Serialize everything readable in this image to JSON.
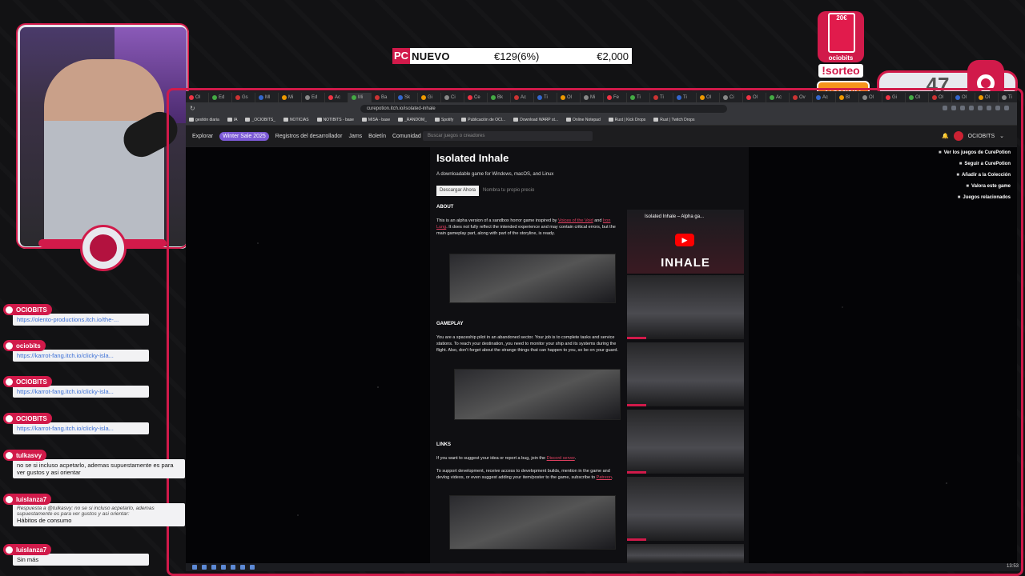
{
  "overlay": {
    "price_banner": {
      "store_mark": "PC",
      "game_name": "NUEVO",
      "discount_price": "€129(6%)",
      "full_price": "€2,000"
    },
    "badge": {
      "top_text": "20€",
      "label": "ociobits"
    },
    "sorteo": "!sorteo",
    "gaming_badge": "GAMING",
    "counter": "47"
  },
  "browser": {
    "tabs": [
      "Ol",
      "Ed",
      "Gs",
      "Ml",
      "Mi",
      "Ed",
      "Ac",
      "Mi",
      "Ba",
      "Sk",
      "Gi",
      "Ci",
      "Ce",
      "Bk",
      "Ac",
      "Ti",
      "Ol",
      "Mi",
      "Fe",
      "Ti",
      "Ti",
      "Ti",
      "Ol",
      "Ci",
      "Ol",
      "Ac",
      "Ov",
      "Ac",
      "Bl",
      "Ol",
      "Gi",
      "Ol",
      "Ol",
      "Ol",
      "Ol",
      "Ti",
      "Ol",
      "Ol",
      "Ol",
      "Ol",
      "Ol",
      "Ol",
      "Ol",
      "Ol"
    ],
    "url": "curepotion.itch.io/isolated-inhale",
    "bookmarks": [
      "gestión diaria",
      "IA",
      "_OCIOBITS_",
      "NOTICIAS",
      "NOTIBITS - base",
      "MISA - base",
      "_RANDOM_",
      "Spotify",
      "Publicación de OCI...",
      "Download WARP st...",
      "Online Notepad",
      "Rust | Kick Drops",
      "Rust | Twitch Drops"
    ],
    "nav": {
      "explore": "Explorar",
      "sale": "Winter Sale 2025",
      "devlogs": "Registros del desarrollador",
      "jams": "Jams",
      "newsletter": "Boletín",
      "community": "Comunidad",
      "search_placeholder": "Buscar juegos o creadores",
      "username": "OCIOBITS"
    },
    "game": {
      "title": "Isolated Inhale",
      "subtitle": "A downloadable game for Windows, macOS, and Linux",
      "download_button": "Descargar Ahora",
      "name_price": "Nombra tu propio precio",
      "about_heading": "ABOUT",
      "about_text_1": "This is an alpha version of a sandbox horror game inspired by ",
      "about_link_1": "Voices of the Void",
      "about_text_2": " and ",
      "about_link_2": "Iron Lung",
      "about_text_3": ". It does not fully reflect the intended experience and may contain critical errors, but the main gameplay part, along with part of the storyline, is ready.",
      "gameplay_heading": "GAMEPLAY",
      "gameplay_text": "You are a spaceship pilot in an abandoned sector. Your job is to complete tasks and service stations. To reach your destination, you need to monitor your ship and its systems during the flight. Also, don't forget about the strange things that can happen to you, so be on your guard.",
      "links_heading": "LINKS",
      "links_text_1": "If you want to suggest your idea or report a bug, join the ",
      "links_link_1": "Discord server",
      "links_text_2": ".",
      "links_text_3": "To support development, receive access to development builds, mention in the game and devlog videos, or even suggest adding your item/poster to the game, subscribe to ",
      "links_link_2": "Patreon",
      "links_text_4": ".",
      "video_title": "Isolated Inhale – Alpha ga...",
      "video_logo": "INHALE"
    },
    "right_links": [
      "Ver los juegos de CurePotion",
      "Seguir a CurePotion",
      "Añadir a la Colección",
      "Valora este game",
      "Juegos relacionados"
    ],
    "clock": "13:53"
  },
  "chat": [
    {
      "user": "OCIOBITS",
      "text": "https://olento-productions.itch.io/the-..."
    },
    {
      "user": "ociobits",
      "text": "https://karrot-fang.itch.io/clicky-isla..."
    },
    {
      "user": "OCIOBITS",
      "text": "https://karrot-fang.itch.io/clicky-isla..."
    },
    {
      "user": "OCIOBITS",
      "text": "https://karrot-fang.itch.io/clicky-isla..."
    },
    {
      "user": "tulkasvy",
      "text": "no se si incluso acpetarlo, ademas supuestamente es para ver gustos y asi orientar"
    },
    {
      "user": "luislanza7",
      "reply": "Respuesta a @tulkasvy: no se si incluso acpetarlo, ademas supuestamente es para ver gustos y asi orientar:",
      "text": "Hábitos de consumo"
    },
    {
      "user": "luislanza7",
      "text": "Sin más"
    }
  ],
  "colors": {
    "accent": "#d11a4a",
    "link": "#3b6fd6",
    "sale": "#7c5ad6"
  }
}
